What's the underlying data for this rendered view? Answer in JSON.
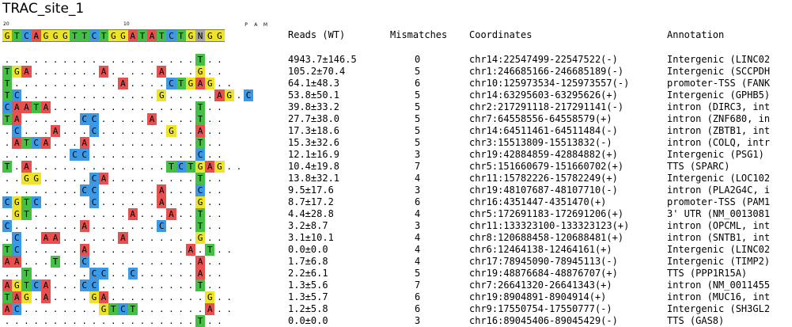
{
  "title": "TRAC_site_1",
  "ruler": {
    "left": "20",
    "mid": "10",
    "pam_letters": [
      "P",
      "A",
      "M"
    ]
  },
  "reference_seq": "GTCAGGGTTCTGGATATCTGNGG",
  "columns": {
    "reads": "Reads (WT)",
    "mismatches": "Mismatches",
    "coordinates": "Coordinates",
    "annotation": "Annotation"
  },
  "colors": {
    "A": "#e84f4f",
    "C": "#3c99e6",
    "G": "#ece32a",
    "T": "#44c044",
    "N": "#a4a4a4",
    "match": "#ffffff"
  },
  "rows": [
    {
      "seq": "....................T..",
      "reads": "4943.7±146.5",
      "mismatches": "0",
      "coord": "chr14:22547499-22547522(-)",
      "annot": "Intergenic (LINC02"
    },
    {
      "seq": "TGA.......A.....A...G..",
      "reads": "105.2±70.4",
      "mismatches": "5",
      "coord": "chr1:246685166-246685189(-)",
      "annot": "Intergenic (SCCPDH"
    },
    {
      "seq": "T...........A....CTGAG..",
      "reads": "64.1±48.3",
      "mismatches": "6",
      "coord": "chr10:125973534-125973557(-)",
      "annot": "promoter-TSS (FANK"
    },
    {
      "seq": "TC..............G.....AG.C",
      "reads": "53.8±50.1",
      "mismatches": "5",
      "coord": "chr14:63295603-63295626(+)",
      "annot": "Intergenic (GPHB5)"
    },
    {
      "seq": "CAATA...............T..",
      "reads": "39.8±33.2",
      "mismatches": "5",
      "coord": "chr2:217291118-217291141(-)",
      "annot": "intron (DIRC3, int"
    },
    {
      "seq": "TA......CC.....A....T..",
      "reads": "27.7±38.0",
      "mismatches": "5",
      "coord": "chr7:64558556-64558579(+)",
      "annot": "intron (ZNF680, in"
    },
    {
      "seq": ".C...A...C.......G..A..",
      "reads": "17.3±18.6",
      "mismatches": "5",
      "coord": "chr14:64511461-64511484(-)",
      "annot": "intron (ZBTB1, int"
    },
    {
      "seq": ".ATCA...A...........T..",
      "reads": "15.3±32.6",
      "mismatches": "5",
      "coord": "chr3:15513809-15513832(-)",
      "annot": "intron (COLQ, intr"
    },
    {
      "seq": ".......CC...........C..",
      "reads": "12.1±16.9",
      "mismatches": "3",
      "coord": "chr19:42884859-42884882(+)",
      "annot": "Intergenic (PSG1)"
    },
    {
      "seq": "T.A..............TCTGAG..",
      "reads": "10.4±19.8",
      "mismatches": "7",
      "coord": "chr5:151660679-151660702(+)",
      "annot": "TTS (SPARC)"
    },
    {
      "seq": "..GG.....CA.........T..",
      "reads": "13.8±32.1",
      "mismatches": "4",
      "coord": "chr11:15782226-15782249(+)",
      "annot": "Intergenic (LOC102"
    },
    {
      "seq": "........CC......A...C..",
      "reads": "9.5±17.6",
      "mismatches": "3",
      "coord": "chr19:48107687-48107710(-)",
      "annot": "intron (PLA2G4C, i"
    },
    {
      "seq": "CGTC.....C......A...G..",
      "reads": "8.7±17.2",
      "mismatches": "6",
      "coord": "chr16:4351447-4351470(+)",
      "annot": "promoter-TSS (PAM1"
    },
    {
      "seq": ".GT..........A...A..T..",
      "reads": "4.4±28.8",
      "mismatches": "4",
      "coord": "chr5:172691183-172691206(+)",
      "annot": "3' UTR (NM_0013081"
    },
    {
      "seq": "C.......A.......C...T..",
      "reads": "3.2±8.7",
      "mismatches": "3",
      "coord": "chr11:133323100-133323123(+)",
      "annot": "intron (OPCML, int"
    },
    {
      "seq": ".C..AA......A.......G..",
      "reads": "3.1±10.1",
      "mismatches": "4",
      "coord": "chr8:120688458-120688481(+)",
      "annot": "intron (SNTB1, int"
    },
    {
      "seq": "TC......A..........A.T..",
      "reads": "0.0±0.0",
      "mismatches": "4",
      "coord": "chr6:12464138-12464161(+)",
      "annot": "Intergenic (LINC02"
    },
    {
      "seq": "AA...T..C...........A..",
      "reads": "1.7±6.8",
      "mismatches": "4",
      "coord": "chr17:78945090-78945113(-)",
      "annot": "Intergenic (TIMP2)"
    },
    {
      "seq": "..T......CC..C......A..",
      "reads": "2.2±6.1",
      "mismatches": "5",
      "coord": "chr19:48876684-48876707(+)",
      "annot": "TTS (PPP1R15A)"
    },
    {
      "seq": "AGTCA...CC..........T..",
      "reads": "1.3±5.6",
      "mismatches": "7",
      "coord": "chr7:26641320-26641343(+)",
      "annot": "intron (NM_0011455"
    },
    {
      "seq": "TAG.A....GA..........G..",
      "reads": "1.3±5.7",
      "mismatches": "6",
      "coord": "chr19:8904891-8904914(+)",
      "annot": "intron (MUC16, int"
    },
    {
      "seq": "AC........GTCT.......A..",
      "reads": "1.2±5.8",
      "mismatches": "6",
      "coord": "chr9:17550754-17550777(-)",
      "annot": "Intergenic (SH3GL2"
    },
    {
      "seq": "....................T..",
      "reads": "0.0±0.0",
      "mismatches": "3",
      "coord": "chr16:89045406-89045429(-)",
      "annot": "TTS (GAS8)"
    }
  ]
}
